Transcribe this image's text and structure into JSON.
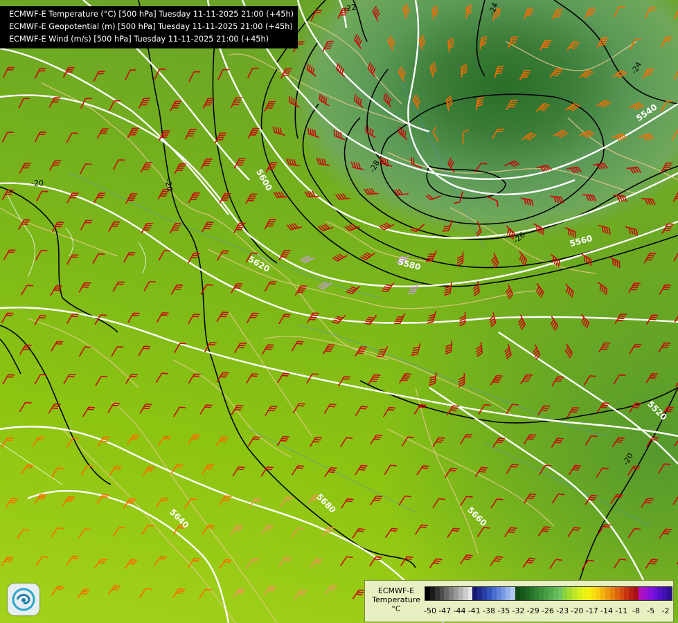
{
  "header": {
    "line1": "ECMWF-E Temperature (°C) [500 hPa] Tuesday 11-11-2025 21:00 (+45h)",
    "line2": "ECMWF-E Geopotential (m) [500 hPa] Tuesday 11-11-2025 21:00 (+45h)",
    "line3": "ECMWF-E Wind (m/s) [500 hPa] Tuesday 11-11-2025 21:00 (+45h)"
  },
  "geopotential_labels": [
    "5540",
    "5560",
    "5580",
    "5600",
    "5520",
    "5620",
    "5680",
    "5660",
    "5640"
  ],
  "temperature_labels": [
    "-22",
    "-24",
    "-24",
    "-20",
    "-28",
    "-26",
    "-20",
    "-20"
  ],
  "legend": {
    "line1": "ECMWF-E",
    "line2": "Temperature",
    "line3": "°C",
    "ticks": [
      "-50",
      "-47",
      "-44",
      "-41",
      "-38",
      "-35",
      "-32",
      "-29",
      "-26",
      "-23",
      "-20",
      "-17",
      "-14",
      "-11",
      "-8",
      "-5",
      "-2"
    ],
    "colors": [
      "#000000",
      "#1a1a1a",
      "#333333",
      "#4d4d4d",
      "#666666",
      "#808080",
      "#999999",
      "#b3b3b3",
      "#cccccc",
      "#e6e6e6",
      "#191970",
      "#1f2a8a",
      "#283fa3",
      "#3355bb",
      "#4a6ccc",
      "#5f84d8",
      "#7a9be2",
      "#96b2ea",
      "#b0c8f0",
      "#0f4a12",
      "#16581a",
      "#1e6622",
      "#27742b",
      "#318233",
      "#3c903c",
      "#489e45",
      "#55ac4e",
      "#63b858",
      "#72c462",
      "#8cd240",
      "#a6dc30",
      "#bfe628",
      "#d6ee20",
      "#e8f218",
      "#f4f010",
      "#f8e010",
      "#f8cc10",
      "#f4b410",
      "#ee9a10",
      "#e68010",
      "#de6610",
      "#d44c10",
      "#c83412",
      "#bb1e14",
      "#a81018",
      "#b010c0",
      "#9c10d0",
      "#8410d8",
      "#6c10d8",
      "#5410c8",
      "#4010b0",
      "#2c1090"
    ]
  },
  "colors": {
    "wind_barb_red": "#c80a0a",
    "wind_barb_orange": "#ff6a00",
    "wind_barb_peach": "#ef9555",
    "wind_barb_violet": "#c79ad3",
    "geopotential_line": "#ffffff",
    "temperature_line": "#000000",
    "border_line": "#e6c98a",
    "river_line": "#4a90c8"
  }
}
